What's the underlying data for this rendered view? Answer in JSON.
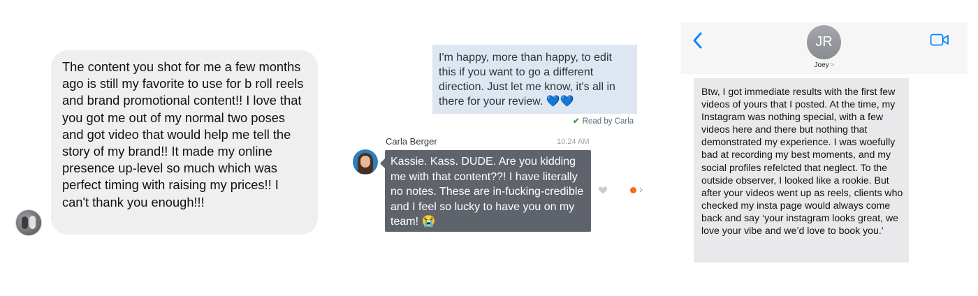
{
  "panel1": {
    "message": "The content you shot for me a few months ago is still my favorite to use for b roll reels and brand promotional content!! I love that you got me out of my normal two poses and got video that would help me tell the story of my brand!! It made my online presence up-level so much which was perfect timing with raising my prices!! I can't thank you enough!!!",
    "bubble_color": "#efefef"
  },
  "panel2": {
    "outgoing_message": "I'm happy, more than happy, to edit this if you want to go a different direction. Just let me know, it's all in there for your review. 💙💙",
    "read_receipt": "Read by Carla",
    "sender_name": "Carla Berger",
    "timestamp": "10:24 AM",
    "incoming_message": "Kassie. Kass. DUDE. Are you kidding me with that content??! I have literally no notes. These are in-fucking-credible and I feel so lucky to have you on my team! 😭",
    "icons": [
      "heart-icon",
      "status-dot-icon",
      "chevron-right-icon"
    ],
    "colors": {
      "outgoing_bubble": "#dee7f1",
      "incoming_bubble": "#5f646c",
      "status_dot": "#f46a1f",
      "check": "#2f9e44"
    }
  },
  "panel3": {
    "avatar_initials": "JR",
    "contact_name": "Joey",
    "contact_chevron": ">",
    "message": "Btw, I got immediate results with the first few videos of yours that I posted. At the time, my Instagram was nothing special, with a few videos here and there but nothing that demonstrated my experience. I was woefully bad at recording my best moments, and my social profiles refelcted that neglect. To the outside observer, I looked like a rookie. But after your videos went up as reels, clients who checked my insta page would always come back and say ‘your instagram looks great, we love your vibe and we’d love to book you.’",
    "icons": [
      "back-chevron-icon",
      "video-call-icon"
    ],
    "accent_color": "#0a84ff"
  }
}
